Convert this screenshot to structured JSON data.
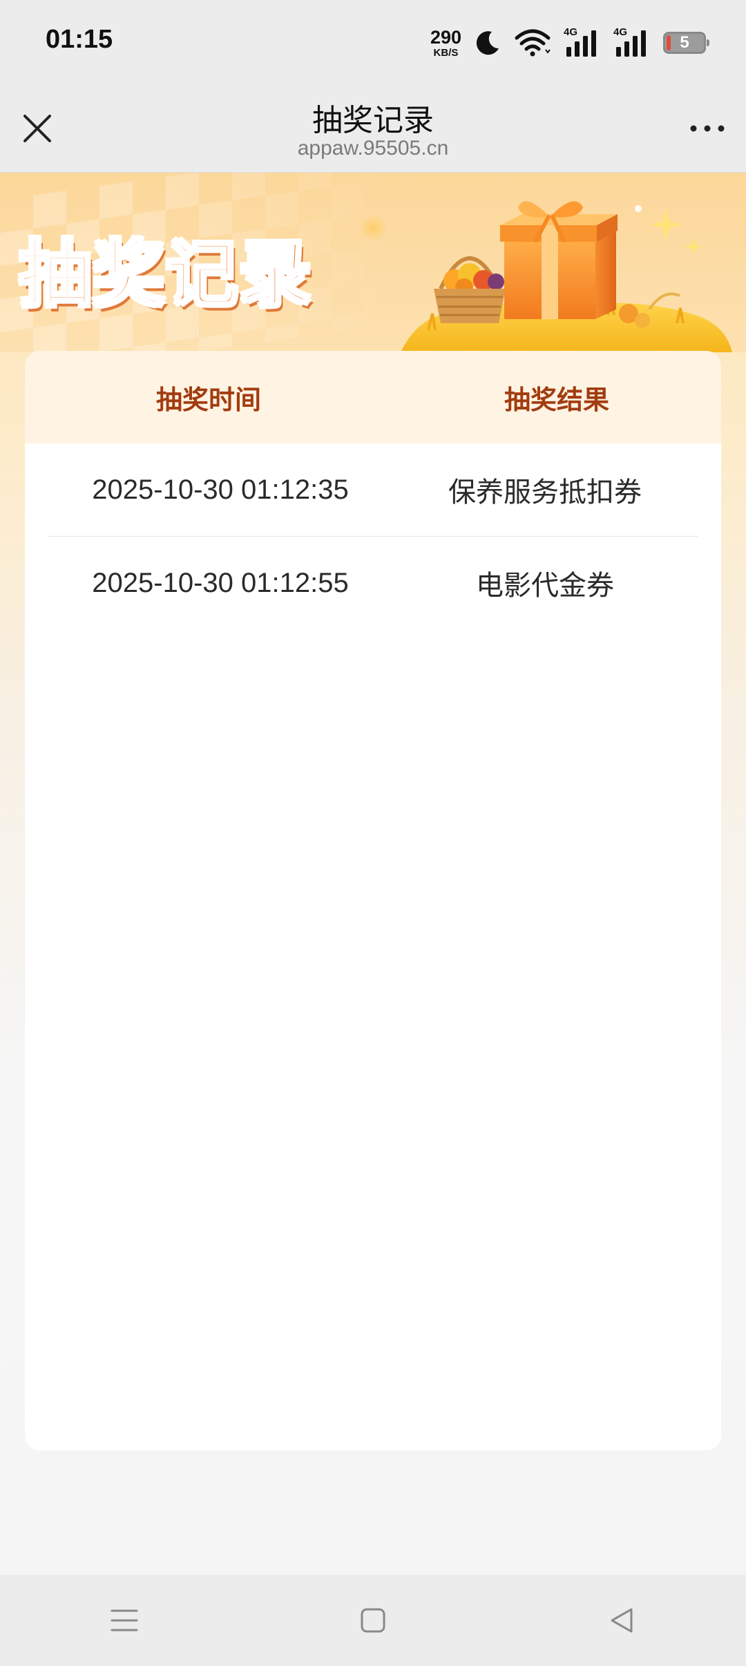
{
  "status_bar": {
    "time": "01:15",
    "net_speed_value": "290",
    "net_speed_unit": "KB/S",
    "signal_1_label": "4G",
    "signal_2_label": "4G",
    "battery_level": "5",
    "icons": [
      "moon-icon",
      "wifi-icon",
      "signal-icon",
      "signal-icon",
      "battery-icon"
    ]
  },
  "nav": {
    "title": "抽奖记录",
    "subtitle": "appaw.95505.cn",
    "close_icon": "close-icon",
    "more_icon": "more-icon"
  },
  "banner": {
    "title": "抽奖记录"
  },
  "table": {
    "headers": [
      "抽奖时间",
      "抽奖结果"
    ],
    "rows": [
      {
        "time": "2025-10-30 01:12:35",
        "result": "保养服务抵扣券"
      },
      {
        "time": "2025-10-30 01:12:55",
        "result": "电影代金券"
      }
    ]
  },
  "system_nav": {
    "icons": [
      "menu-icon",
      "home-icon",
      "back-icon"
    ]
  },
  "colors": {
    "header_text": "#a23c10",
    "header_bg": "#fff4e3",
    "banner_title": "#ef6a1d",
    "status_bg": "#ececec"
  }
}
